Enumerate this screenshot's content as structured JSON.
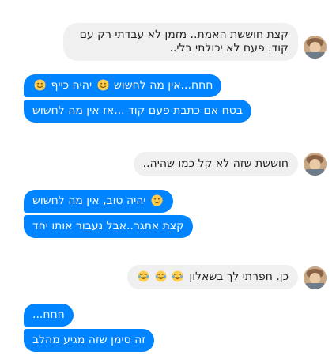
{
  "conversation": {
    "messages": [
      {
        "sender": "contact",
        "text_line1": "קצת חוששת האמת.. מזמן לא עבדתי רק עם",
        "text_line2": "קוד. פעם לא יכולתי בלי.."
      },
      {
        "sender": "me",
        "text_before": "חחח...אין מה לחשוש",
        "emoji1": "smiling-face",
        "text_mid": "יהיה כייף",
        "emoji2": "smiling-face"
      },
      {
        "sender": "me",
        "text": "בטח אם כתבת פעם קוד ...אז אין מה לחשוש"
      },
      {
        "sender": "contact",
        "text": "חוששת שזה לא קל כמו שהיה.."
      },
      {
        "sender": "me",
        "text": "יהיה טוב, אין מה לחשוש",
        "emoji": "smiling-face"
      },
      {
        "sender": "me",
        "text": "קצת אתגר..אבל נעבור אותו יחד"
      },
      {
        "sender": "contact",
        "text": "כן. חפרתי לך בשאלון",
        "emoji": "tears-of-joy x3"
      },
      {
        "sender": "me",
        "text": "חחח..."
      },
      {
        "sender": "me",
        "text": "זה סימן שזה מגיע מהלב"
      }
    ],
    "colors": {
      "outgoing": "#0084ff",
      "incoming": "#f1f0f0",
      "text_dark": "#1c1e21"
    }
  }
}
